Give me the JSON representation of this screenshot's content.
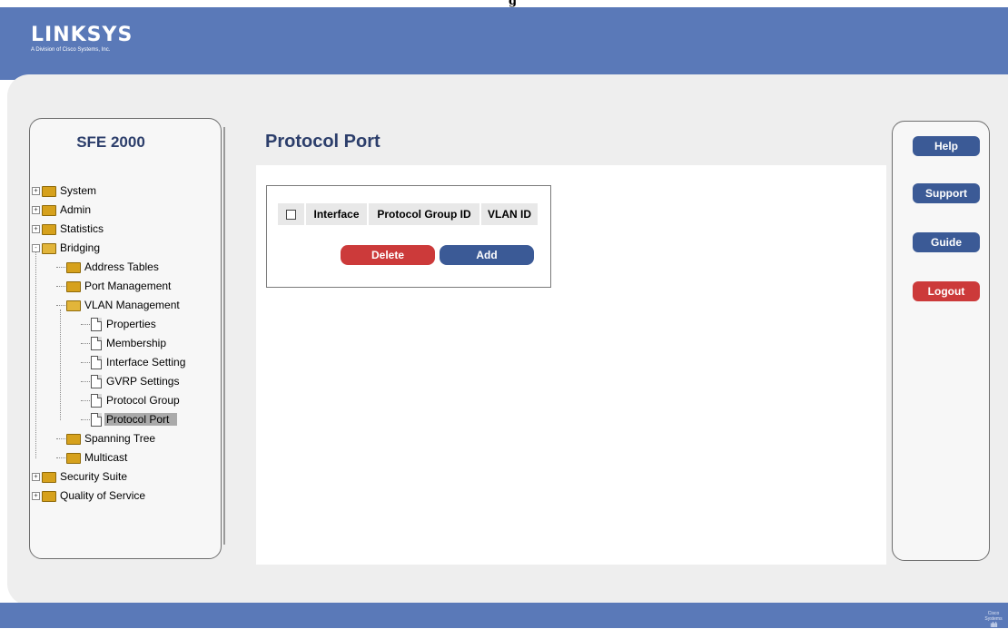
{
  "window_title_fragment": "g",
  "brand": {
    "name": "LINKSYS",
    "tagline": "A Division of Cisco Systems, Inc."
  },
  "footer": {
    "vendor": "Cisco Systems"
  },
  "sidebar": {
    "product": "SFE 2000",
    "items": [
      {
        "label": "System",
        "level": 0,
        "type": "folder",
        "expander": "+"
      },
      {
        "label": "Admin",
        "level": 0,
        "type": "folder",
        "expander": "+"
      },
      {
        "label": "Statistics",
        "level": 0,
        "type": "folder",
        "expander": "+"
      },
      {
        "label": "Bridging",
        "level": 0,
        "type": "folder-open",
        "expander": "-"
      },
      {
        "label": "Address Tables",
        "level": 1,
        "type": "folder"
      },
      {
        "label": "Port Management",
        "level": 1,
        "type": "folder"
      },
      {
        "label": "VLAN Management",
        "level": 1,
        "type": "folder-open"
      },
      {
        "label": "Properties",
        "level": 2,
        "type": "doc"
      },
      {
        "label": "Membership",
        "level": 2,
        "type": "doc"
      },
      {
        "label": "Interface Setting",
        "level": 2,
        "type": "doc"
      },
      {
        "label": "GVRP Settings",
        "level": 2,
        "type": "doc"
      },
      {
        "label": "Protocol Group",
        "level": 2,
        "type": "doc"
      },
      {
        "label": "Protocol Port",
        "level": 2,
        "type": "doc",
        "selected": true
      },
      {
        "label": "Spanning Tree",
        "level": 1,
        "type": "folder"
      },
      {
        "label": "Multicast",
        "level": 1,
        "type": "folder"
      },
      {
        "label": "Security Suite",
        "level": 0,
        "type": "folder",
        "expander": "+"
      },
      {
        "label": "Quality of Service",
        "level": 0,
        "type": "folder",
        "expander": "+"
      }
    ]
  },
  "main": {
    "title": "Protocol Port",
    "table": {
      "columns": [
        "Interface",
        "Protocol Group ID",
        "VLAN ID"
      ],
      "select_all_checked": false
    },
    "buttons": {
      "delete": "Delete",
      "add": "Add"
    }
  },
  "right_panel": {
    "help": "Help",
    "support": "Support",
    "guide": "Guide",
    "logout": "Logout"
  },
  "colors": {
    "header_blue": "#5a79b8",
    "title_navy": "#2c3e6b",
    "button_blue": "#3b5a96",
    "button_red": "#cc3a3a",
    "selection_gray": "#aaaaaa"
  }
}
